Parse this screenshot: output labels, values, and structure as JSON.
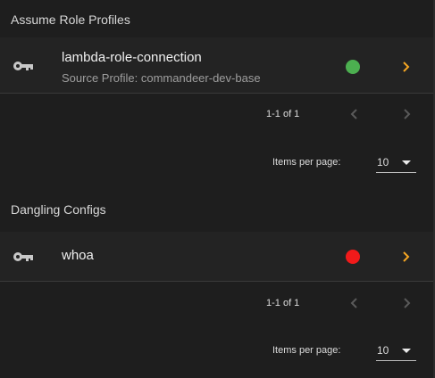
{
  "sections": [
    {
      "title": "Assume Role Profiles",
      "item": {
        "name": "lambda-role-connection",
        "subtitle": "Source Profile: commandeer-dev-base",
        "status_color": "#4caf50"
      },
      "pagination": {
        "range": "1-1 of 1",
        "items_per_page_label": "Items per page:",
        "items_per_page_value": "10"
      }
    },
    {
      "title": "Dangling Configs",
      "item": {
        "name": "whoa",
        "status_color": "#f11a1a"
      },
      "pagination": {
        "range": "1-1 of 1",
        "items_per_page_label": "Items per page:",
        "items_per_page_value": "10"
      }
    }
  ],
  "colors": {
    "accent": "#f5a623",
    "icon": "#c8c8c8",
    "pager_arrow_disabled": "#5a5a5a"
  },
  "icons": {
    "item_icon": "key-icon",
    "item_action": "chevron-right-icon",
    "prev_page": "chevron-left-icon",
    "next_page": "chevron-right-icon",
    "dropdown": "caret-down-icon"
  }
}
